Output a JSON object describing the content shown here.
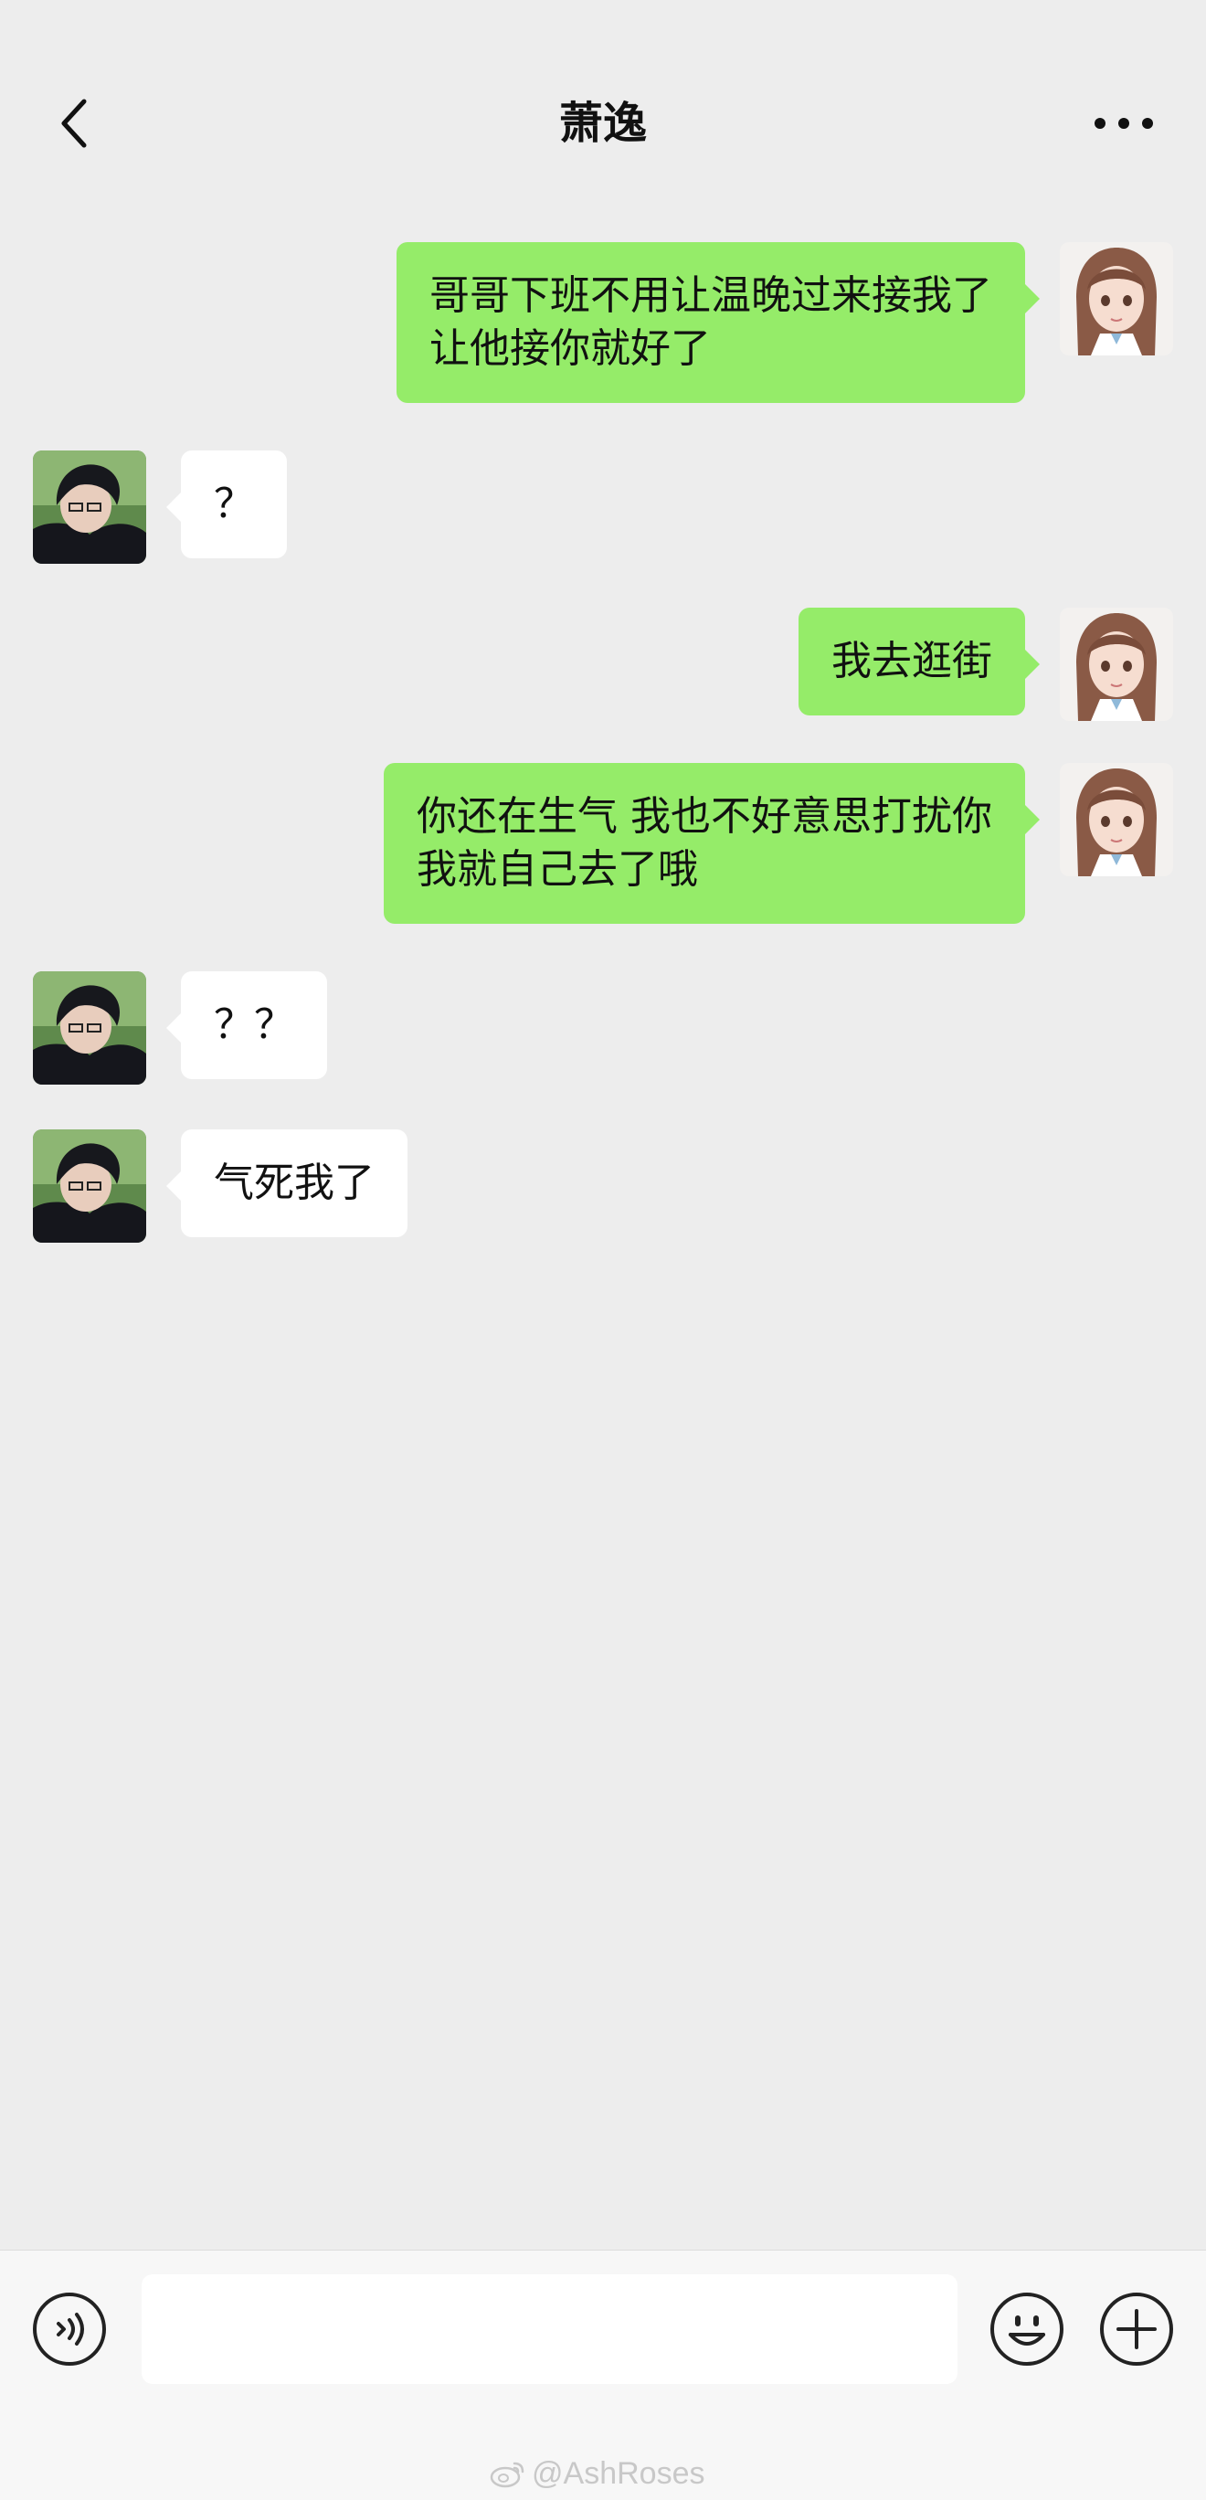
{
  "header": {
    "title": "萧逸"
  },
  "messages": [
    {
      "side": "right",
      "sender": "me",
      "text": "哥哥下班不用让温晚过来接我了\n让他接你就好了"
    },
    {
      "side": "left",
      "sender": "contact",
      "text": "？"
    },
    {
      "side": "right",
      "sender": "me",
      "text": "我去逛街"
    },
    {
      "side": "right",
      "sender": "me",
      "text": "你还在生气 我也不好意思打扰你\n我就自己去了哦"
    },
    {
      "side": "left",
      "sender": "contact",
      "text": "？？"
    },
    {
      "side": "left",
      "sender": "contact",
      "text": "气死我了"
    }
  ],
  "input_bar": {
    "value": "",
    "placeholder": ""
  },
  "watermark": {
    "text": "@AshRoses"
  },
  "icons": {
    "back": "chevron-left-icon",
    "more": "more-dots-icon",
    "voice": "voice-icon",
    "emoji": "emoji-icon",
    "plus": "plus-icon",
    "weibo": "weibo-icon"
  },
  "colors": {
    "background": "#ededed",
    "sent_bubble": "#95ec69",
    "received_bubble": "#ffffff",
    "input_bar": "#f7f7f7"
  }
}
